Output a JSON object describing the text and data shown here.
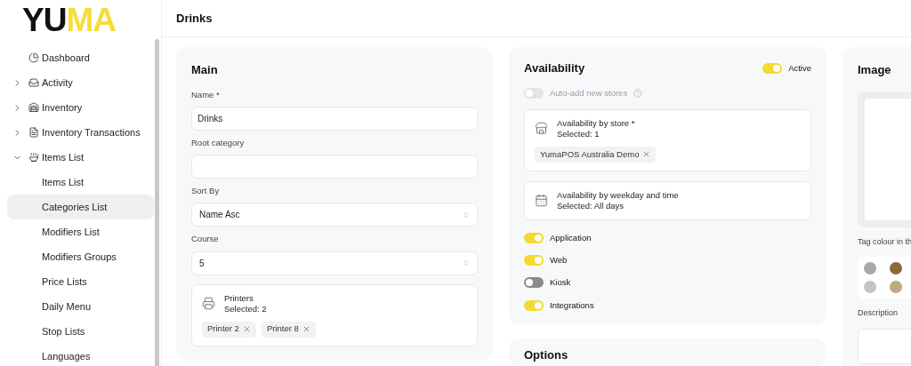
{
  "logo": {
    "dark": "YU",
    "accent": "MA"
  },
  "sidebar": {
    "items": [
      {
        "kind": "link",
        "label": "Dashboard",
        "selected": false
      },
      {
        "kind": "group",
        "label": "Activity",
        "expanded": false,
        "selected": false
      },
      {
        "kind": "group",
        "label": "Inventory",
        "expanded": false,
        "selected": false
      },
      {
        "kind": "group",
        "label": "Inventory Transactions",
        "expanded": false,
        "selected": false
      },
      {
        "kind": "group",
        "label": "Items List",
        "expanded": true,
        "selected": false,
        "children": [
          {
            "label": "Items List",
            "selected": false
          },
          {
            "label": "Categories List",
            "selected": true
          },
          {
            "label": "Modifiers List",
            "selected": false
          },
          {
            "label": "Modifiers Groups",
            "selected": false
          },
          {
            "label": "Price Lists",
            "selected": false
          },
          {
            "label": "Daily Menu",
            "selected": false
          },
          {
            "label": "Stop Lists",
            "selected": false
          },
          {
            "label": "Languages",
            "selected": false
          }
        ]
      }
    ]
  },
  "header": {
    "title": "Drinks"
  },
  "main": {
    "title": "Main",
    "fields": [
      {
        "kind": "text",
        "label": "Name *",
        "value": "Drinks"
      },
      {
        "kind": "text",
        "label": "Root category"
      },
      {
        "kind": "select",
        "label": "Sort By",
        "value": "Name Asc"
      },
      {
        "kind": "select",
        "label": "Course",
        "value": "5"
      }
    ],
    "printers": {
      "title": "Printers",
      "summary": "Selected: 2",
      "tags": [
        "Printer 2",
        "Printer 8"
      ]
    }
  },
  "availability": {
    "title": "Availability",
    "active": {
      "label": "Active",
      "on": true
    },
    "auto_add": {
      "label": "Auto-add new stores",
      "on": false,
      "disabled": true
    },
    "blocks": [
      {
        "title": "Availability by store *",
        "summary": "Selected: 1",
        "tags": [
          "YumaPOS Australia Demo"
        ]
      },
      {
        "title": "Availability by weekday and time",
        "summary": "Selected: All days"
      }
    ],
    "channels": [
      {
        "label": "Application",
        "on": true
      },
      {
        "label": "Web",
        "on": true
      },
      {
        "label": "Kiosk",
        "on": false
      },
      {
        "label": "Integrations",
        "on": true
      }
    ]
  },
  "options": {
    "title": "Options"
  },
  "image": {
    "title": "Image",
    "tag_colour_label": "Tag colour in th",
    "colours": [
      {
        "color": "#a9a9a9"
      },
      {
        "color": "#8b6b3a"
      },
      {
        "color": "#c4c4c4"
      },
      {
        "color": "#bfa982"
      }
    ],
    "description_label": "Description"
  }
}
